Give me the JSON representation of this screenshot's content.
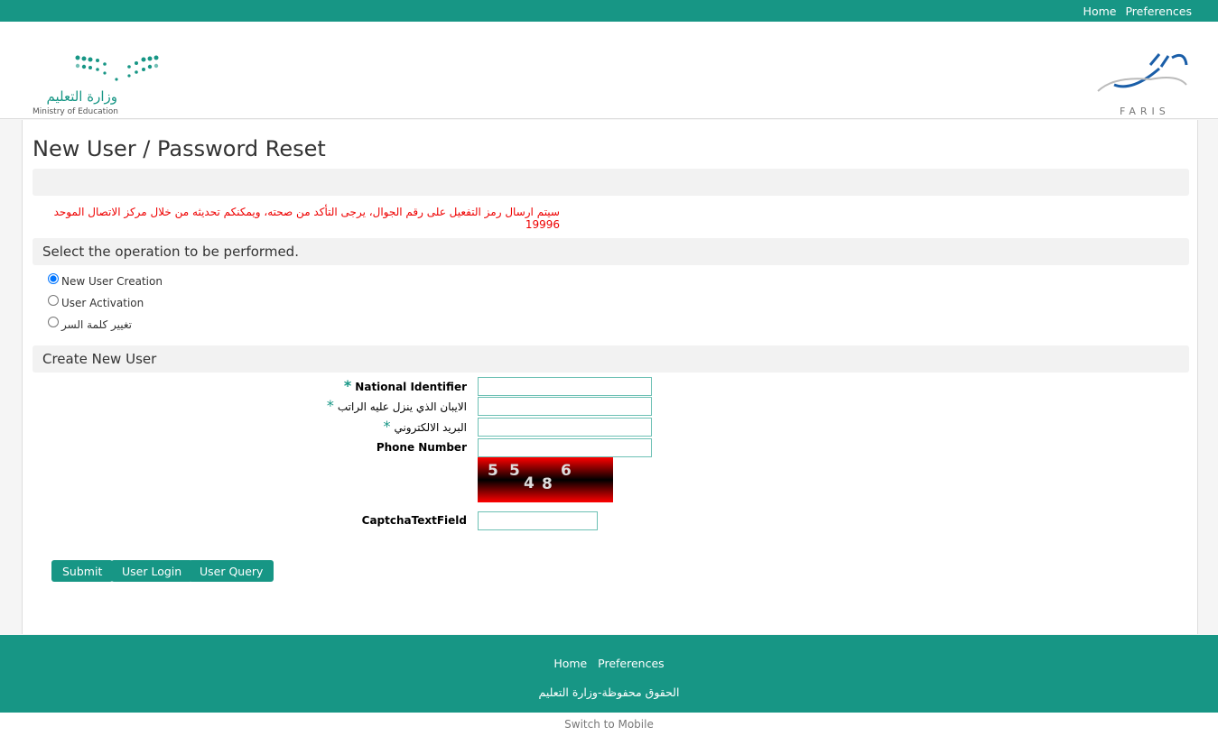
{
  "topnav": {
    "home": "Home",
    "preferences": "Preferences"
  },
  "logos": {
    "moe_ar": "وزارة التعليم",
    "moe_en": "Ministry of Education",
    "faris": "FARIS"
  },
  "colors": {
    "brand": "#179685",
    "notice": "#ee0000"
  },
  "page": {
    "title": "New User / Password Reset",
    "notice": "سيتم ارسال رمز التفعيل على رقم الجوال، يرجى التأكد من صحته، ويمكنكم تحديثه من خلال مركز الاتصال الموحد 19996",
    "operation_header": "Select the operation to be performed.",
    "operations": [
      {
        "label": "New User Creation",
        "selected": true
      },
      {
        "label": "User Activation",
        "selected": false
      },
      {
        "label": "تغيير كلمة السر",
        "selected": false
      }
    ],
    "form_header": "Create New User",
    "fields": {
      "national_id": "National Identifier",
      "iban": "الايبان الذي ينزل عليه الراتب",
      "email": "البريد الالكتروني",
      "phone": "Phone Number",
      "captcha": "CaptchaTextField"
    },
    "required_mark": "*",
    "captcha_digits": [
      "5",
      "5",
      "4",
      "8",
      "6"
    ],
    "buttons": {
      "submit": "Submit",
      "login": "User Login",
      "query": "User Query"
    }
  },
  "footer": {
    "home": "Home",
    "preferences": "Preferences",
    "copyright": "الحقوق محفوظة-وزارة التعليم",
    "switch_mobile": "Switch to Mobile"
  }
}
